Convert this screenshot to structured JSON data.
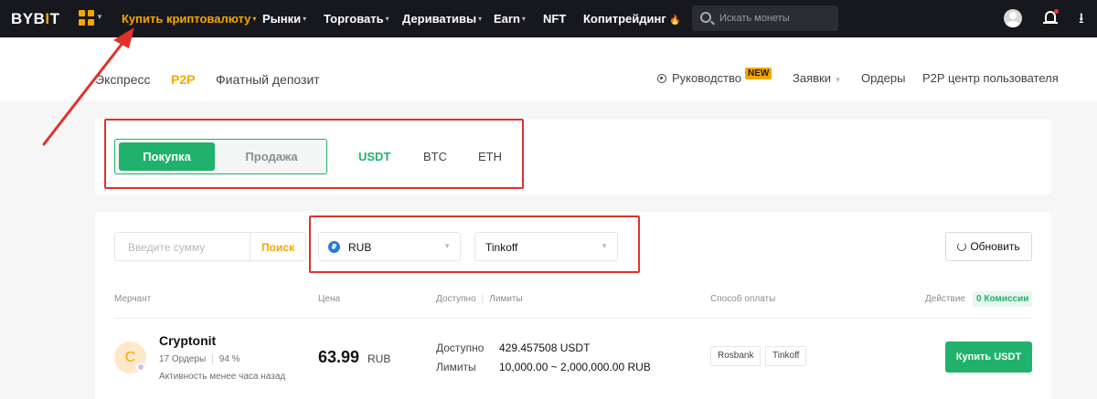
{
  "nav": {
    "logo_text": "BYB",
    "logo_bar": "I",
    "logo_tail": "T",
    "items": [
      {
        "label": "Купить криптовалюту",
        "caret": "▾"
      },
      {
        "label": "Рынки",
        "caret": "▾"
      },
      {
        "label": "Торговать",
        "caret": "▾"
      },
      {
        "label": "Деривативы",
        "caret": "▾"
      },
      {
        "label": "Earn",
        "caret": "▾"
      },
      {
        "label": "NFT",
        "caret": ""
      },
      {
        "label": "Копитрейдинг",
        "caret": "🔥"
      }
    ],
    "search_placeholder": "Искать монеты",
    "download_icon": "⭳"
  },
  "subnav": {
    "tabs": [
      "Экспресс",
      "P2P",
      "Фиатный депозит"
    ],
    "guide": "Руководство",
    "new_badge": "NEW",
    "orders_menu": "Заявки",
    "orders": "Ордеры",
    "user_center": "P2P центр пользователя"
  },
  "trade": {
    "buy_label": "Покупка",
    "sell_label": "Продажа",
    "coins": [
      "USDT",
      "BTC",
      "ETH"
    ]
  },
  "filters": {
    "amount_placeholder": "Введите сумму",
    "search_label": "Поиск",
    "currency": "RUB",
    "currency_icon": "₽",
    "payment": "Tinkoff",
    "refresh_label": "Обновить"
  },
  "table": {
    "headers": {
      "merchant": "Мерчант",
      "price": "Цена",
      "available": "Доступно",
      "limits": "Лимиты",
      "payment": "Способ оплаты",
      "action": "Действие",
      "zero_fee": "0 Комиссии"
    },
    "rows": [
      {
        "avatar_letter": "C",
        "name": "Cryptonit",
        "orders": "17 Ордеры",
        "completion": "94 %",
        "activity": "Активность менее часа назад",
        "price": "63.99",
        "price_currency": "RUB",
        "available_label": "Доступно",
        "available": "429.457508 USDT",
        "limits_label": "Лимиты",
        "limits": "10,000.00 ~ 2,000,000.00 RUB",
        "payments": [
          "Rosbank",
          "Tinkoff"
        ],
        "action": "Купить USDT"
      }
    ]
  },
  "colors": {
    "accent": "#f7a600",
    "buy_green": "#20b26c",
    "annotation_red": "#e0312c",
    "nav_bg": "#17181e"
  }
}
